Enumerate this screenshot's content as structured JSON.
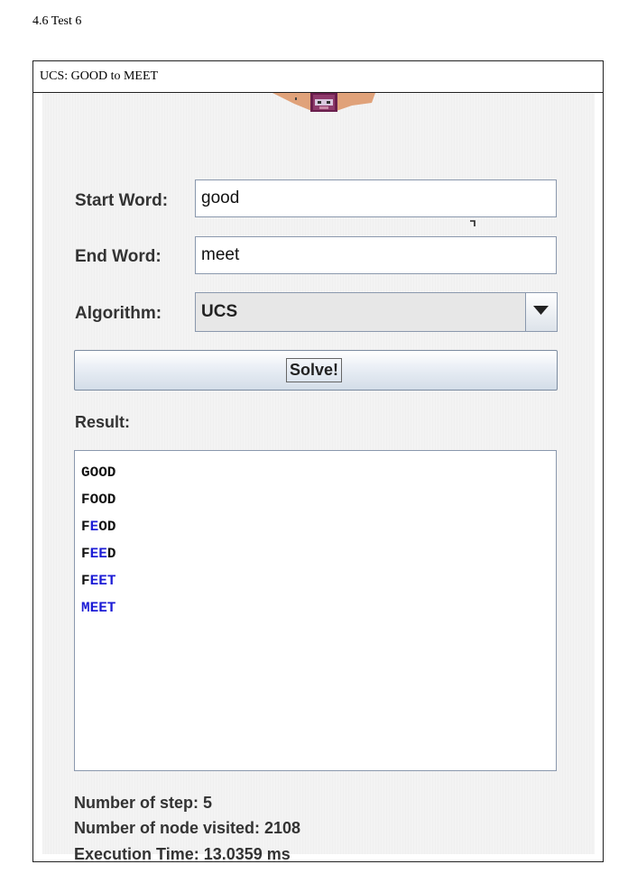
{
  "page": {
    "heading": "4.6 Test 6"
  },
  "window": {
    "title": "UCS: GOOD to MEET"
  },
  "form": {
    "start_word_label": "Start Word:",
    "start_word_value": "good",
    "end_word_label": "End Word:",
    "end_word_value": "meet",
    "algorithm_label": "Algorithm:",
    "algorithm_value": "UCS",
    "dropdown_icon": "triangle-down-icon",
    "solve_label": "Solve!"
  },
  "result": {
    "label": "Result:",
    "lines": [
      [
        {
          "t": "GOOD",
          "hl": false
        }
      ],
      [
        {
          "t": "FOOD",
          "hl": false
        }
      ],
      [
        {
          "t": "F",
          "hl": false
        },
        {
          "t": "E",
          "hl": true
        },
        {
          "t": "OD",
          "hl": false
        }
      ],
      [
        {
          "t": "F",
          "hl": false
        },
        {
          "t": "EE",
          "hl": true
        },
        {
          "t": "D",
          "hl": false
        }
      ],
      [
        {
          "t": "F",
          "hl": false
        },
        {
          "t": "EET",
          "hl": true
        }
      ],
      [
        {
          "t": "MEET",
          "hl": true
        }
      ]
    ]
  },
  "stats": {
    "steps": "Number of step: 5",
    "nodes": "Number of node visited: 2108",
    "time": "Execution Time: 13.0359 ms"
  },
  "colors": {
    "highlight": "#1c1cd6",
    "normal": "#111111"
  }
}
